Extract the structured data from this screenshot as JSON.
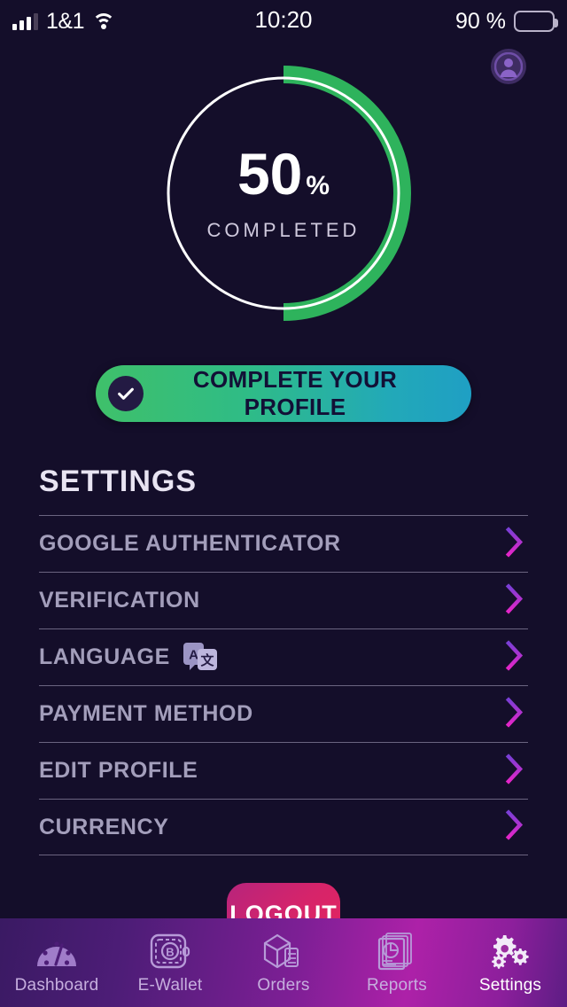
{
  "status_bar": {
    "signal_icon": "signal-bars-icon",
    "carrier": "1&1",
    "wifi_icon": "wifi-icon",
    "time": "10:20",
    "battery_percent": "90 %",
    "battery_icon": "battery-icon"
  },
  "header": {
    "avatar_icon": "user-avatar-icon"
  },
  "progress": {
    "percent_value": "50",
    "percent_symbol": "%",
    "caption": "COMPLETED",
    "percent_number": 50,
    "track_color": "#ffffff",
    "arc_color": "#2eb35c"
  },
  "cta": {
    "check_icon": "check-circle-icon",
    "label": "COMPLETE YOUR PROFILE",
    "gradient_start": "#3fc06a",
    "gradient_end": "#1f9fc4"
  },
  "settings": {
    "title": "SETTINGS",
    "chevron_icon": "chevron-right-icon",
    "chevron_color_top": "#7a3fd6",
    "chevron_color_bottom": "#e425c8",
    "items": [
      {
        "label": "GOOGLE AUTHENTICATOR",
        "icon": null
      },
      {
        "label": "VERIFICATION",
        "icon": null
      },
      {
        "label": "LANGUAGE",
        "icon": "translate-icon"
      },
      {
        "label": "PAYMENT METHOD",
        "icon": null
      },
      {
        "label": "EDIT PROFILE",
        "icon": null
      },
      {
        "label": "CURRENCY",
        "icon": null
      }
    ]
  },
  "logout": {
    "label": "LOGOUT",
    "color": "#d6246a"
  },
  "bottom_nav": {
    "active_index": 4,
    "items": [
      {
        "label": "Dashboard",
        "icon": "speedometer-icon"
      },
      {
        "label": "E-Wallet",
        "icon": "bitcoin-wallet-icon"
      },
      {
        "label": "Orders",
        "icon": "package-box-icon"
      },
      {
        "label": "Reports",
        "icon": "report-chart-icon"
      },
      {
        "label": "Settings",
        "icon": "gears-icon"
      }
    ]
  }
}
